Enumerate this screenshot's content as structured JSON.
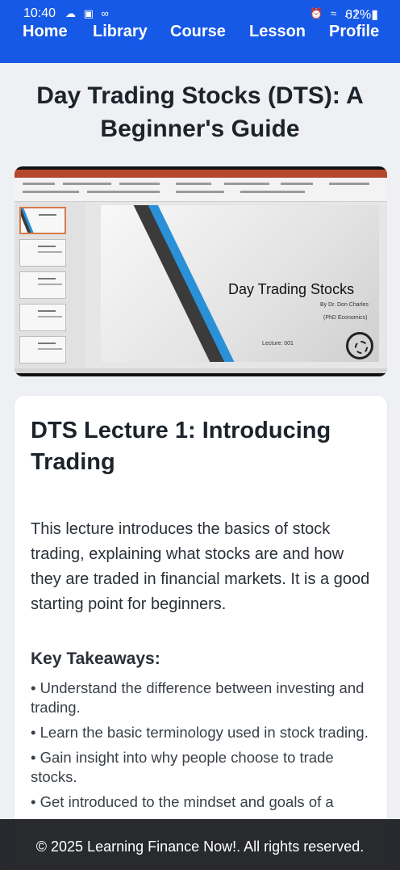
{
  "status_bar": {
    "time": "10:40",
    "left_icons": "☁ ▣ ∞",
    "right_icons": "⏰ ≈ .ıl",
    "battery": "62%▮"
  },
  "nav": {
    "items": [
      {
        "label": "Home"
      },
      {
        "label": "Library"
      },
      {
        "label": "Course"
      },
      {
        "label": "Lesson"
      },
      {
        "label": "Profile"
      }
    ]
  },
  "page": {
    "title": "Day Trading Stocks (DTS): A Beginner's Guide"
  },
  "video": {
    "slide_title": "Day Trading Stocks",
    "slide_author": "By Dr. Don Charles",
    "slide_degree": "(PhD Economics)",
    "slide_lecture": "Lecture: 001"
  },
  "lecture": {
    "title": "DTS Lecture 1: Introducing Trading",
    "description": "This lecture introduces the basics of stock trading, explaining what stocks are and how they are traded in financial markets. It is a good starting point for beginners.",
    "takeaways_heading": "Key Takeaways:",
    "takeaways": [
      "• Understand the difference between investing and trading.",
      "• Learn the basic terminology used in stock trading.",
      "• Gain insight into why people choose to trade stocks.",
      "• Get introduced to the mindset and goals of a"
    ]
  },
  "footer": {
    "copyright": "© 2025 Learning Finance Now!. All rights reserved."
  },
  "colors": {
    "header_bg": "#1659e6",
    "page_bg": "#eef0f4",
    "footer_bg": "#181a1e"
  }
}
